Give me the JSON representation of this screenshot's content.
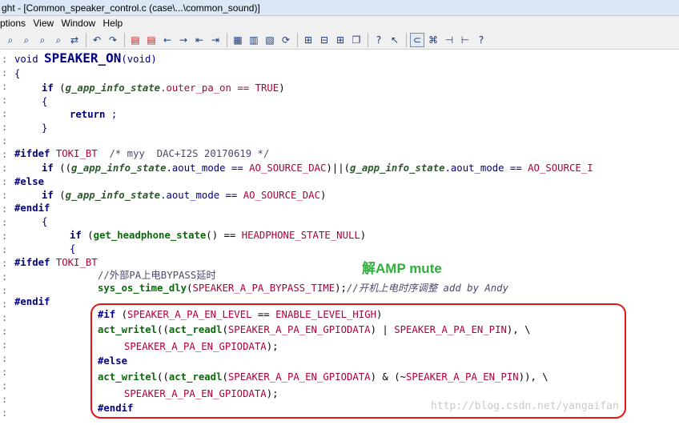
{
  "window": {
    "title": "ght - [Common_speaker_control.c (case\\...\\common_sound)]"
  },
  "menu": [
    "ptions",
    "View",
    "Window",
    "Help"
  ],
  "toolbar_icons": [
    "binoculars-icon",
    "binoculars-back-icon",
    "binoculars-forward-icon",
    "find-files-icon",
    "replace-icon",
    "undo-icon",
    "redo-icon",
    "bookmark-prev-icon",
    "bookmark-next-icon",
    "arrow-left-icon",
    "arrow-right-icon",
    "jump-back-icon",
    "jump-forward-icon",
    "symbol-window-icon",
    "book-icon",
    "dictionary-icon",
    "refresh-icon",
    "layout-1-icon",
    "layout-2-icon",
    "layout-3-icon",
    "layout-4-icon",
    "context-help-icon",
    "pointer-help-icon",
    "sync-icon",
    "relation-icon",
    "tree-left-icon",
    "tree-right-icon",
    "help-icon"
  ],
  "code": {
    "gutter": ":",
    "l1": {
      "kw": "void",
      "name": "SPEAKER_ON",
      "args": "(void)"
    },
    "l2": "{",
    "l3": {
      "kw": "if",
      "open": " (",
      "var": "g_app_info_state",
      "rest": ".outer_pa_on == ",
      "mac": "TRUE",
      "close": ")"
    },
    "l4": "{",
    "l5": {
      "kw": "return",
      "rest": " ;"
    },
    "l6": "}",
    "l7": {
      "pp": "#ifdef",
      "mac": "TOKI_BT",
      "cm": "/* myy  DAC+I2S 20170619 */"
    },
    "l8": {
      "kw": "if",
      "p1": " ((",
      "var1": "g_app_info_state",
      "m1": ".aout_mode == ",
      "mac1": "AO_SOURCE_DAC",
      "p2": ")||(",
      "var2": "g_app_info_state",
      "m2": ".aout_mode == ",
      "mac2": "AO_SOURCE_I"
    },
    "l9": {
      "pp": "#else"
    },
    "l10": {
      "kw": "if",
      "open": " (",
      "var": "g_app_info_state",
      "rest": ".aout_mode == ",
      "mac": "AO_SOURCE_DAC",
      "close": ")"
    },
    "l11": {
      "pp": "#endif"
    },
    "l12": "{",
    "l13": {
      "kw": "if",
      "open": " (",
      "fn": "get_headphone_state",
      "rest": "() == ",
      "mac": "HEADPHONE_STATE_NULL",
      "close": ")"
    },
    "l14": "{",
    "l15": {
      "pp": "#ifdef",
      "mac": "TOKI_BT"
    },
    "l16": {
      "cm": "//外部PA上电BYPASS延时"
    },
    "l17": {
      "fn": "sys_os_time_dly",
      "open": "(",
      "mac": "SPEAKER_A_PA_BYPASS_TIME",
      "close": ");",
      "cm": "//开机上电时序调整 add by Andy"
    },
    "l18": {
      "pp": "#endif"
    },
    "l19": {
      "pp": "#if",
      "open": " (",
      "mac1": "SPEAKER_A_PA_EN_LEVEL",
      "op": " == ",
      "mac2": "ENABLE_LEVEL_HIGH",
      "close": ")"
    },
    "l20": {
      "fn1": "act_writel",
      "p1": "((",
      "fn2": "act_readl",
      "p2": "(",
      "mac1": "SPEAKER_A_PA_EN_GPIODATA",
      "p3": ") | ",
      "mac2": "SPEAKER_A_PA_EN_PIN",
      "p4": "), \\"
    },
    "l21": {
      "mac": "SPEAKER_A_PA_EN_GPIODATA",
      "close": ");"
    },
    "l22": {
      "pp": "#else"
    },
    "l23": {
      "fn1": "act_writel",
      "p1": "((",
      "fn2": "act_readl",
      "p2": "(",
      "mac1": "SPEAKER_A_PA_EN_GPIODATA",
      "p3": ") & (~",
      "mac2": "SPEAKER_A_PA_EN_PIN",
      "p4": ")), \\"
    },
    "l24": {
      "mac": "SPEAKER_A_PA_EN_GPIODATA",
      "close": ");"
    },
    "l25": {
      "pp": "#endif"
    }
  },
  "annotation": "解AMP mute",
  "watermark": "http://blog.csdn.net/yangaifan",
  "colors": {
    "keyword": "#000080",
    "function": "#0a6a0a",
    "macro": "#b0003a",
    "highlight_box": "#e01818",
    "annotation": "#2eaf3a"
  }
}
